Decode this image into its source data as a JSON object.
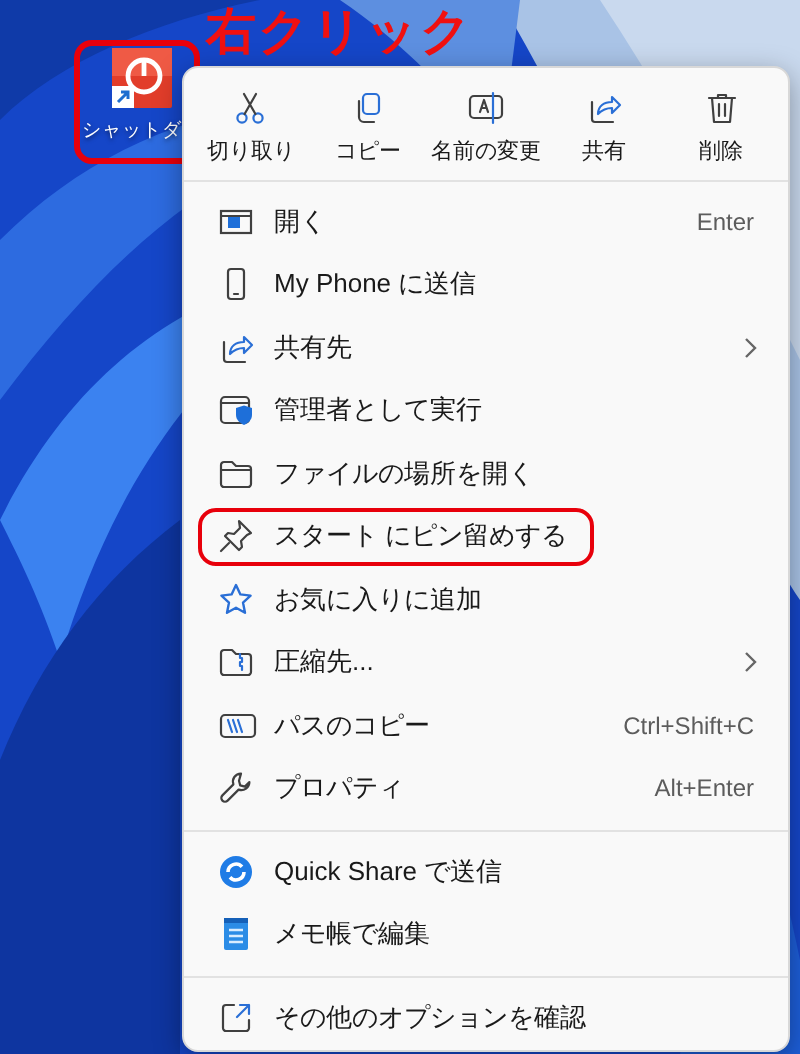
{
  "annotation": {
    "label": "右クリック"
  },
  "desktop_icon": {
    "label": "シャットダ",
    "highlighted": true
  },
  "toolbar": [
    {
      "label": "切り取り"
    },
    {
      "label": "コピー"
    },
    {
      "label": "名前の変更"
    },
    {
      "label": "共有"
    },
    {
      "label": "削除"
    }
  ],
  "items": [
    {
      "kind": "item",
      "label": "開く",
      "shortcut": "Enter",
      "submenu": false,
      "highlighted": false
    },
    {
      "kind": "item",
      "label": "My Phone に送信",
      "submenu": false,
      "highlighted": false
    },
    {
      "kind": "item",
      "label": "共有先",
      "submenu": true,
      "highlighted": false
    },
    {
      "kind": "item",
      "label": "管理者として実行",
      "submenu": false,
      "highlighted": false
    },
    {
      "kind": "item",
      "label": "ファイルの場所を開く",
      "submenu": false,
      "highlighted": false
    },
    {
      "kind": "item",
      "label": "スタート にピン留めする",
      "submenu": false,
      "highlighted": true
    },
    {
      "kind": "item",
      "label": "お気に入りに追加",
      "submenu": false,
      "highlighted": false
    },
    {
      "kind": "item",
      "label": "圧縮先...",
      "submenu": true,
      "highlighted": false
    },
    {
      "kind": "item",
      "label": "パスのコピー",
      "shortcut": "Ctrl+Shift+C",
      "submenu": false,
      "highlighted": false
    },
    {
      "kind": "item",
      "label": "プロパティ",
      "shortcut": "Alt+Enter",
      "submenu": false,
      "highlighted": false
    },
    {
      "kind": "divider"
    },
    {
      "kind": "item",
      "label": "Quick Share で送信",
      "submenu": false,
      "highlighted": false
    },
    {
      "kind": "item",
      "label": "メモ帳で編集",
      "submenu": false,
      "highlighted": false
    },
    {
      "kind": "divider"
    },
    {
      "kind": "item",
      "label": "その他のオプションを確認",
      "submenu": false,
      "highlighted": false
    }
  ]
}
